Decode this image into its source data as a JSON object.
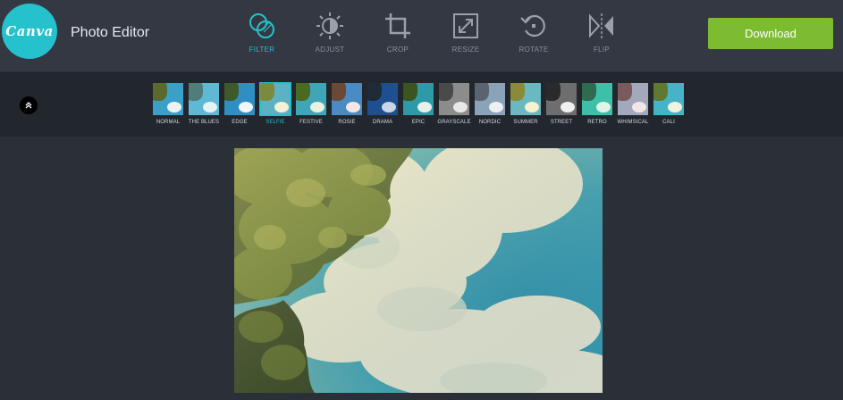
{
  "app": {
    "logo_text": "Canva",
    "title": "Photo Editor"
  },
  "toolbar": {
    "tools": [
      {
        "label": "FILTER",
        "icon": "filter-icon",
        "active": true
      },
      {
        "label": "ADJUST",
        "icon": "adjust-icon",
        "active": false
      },
      {
        "label": "CROP",
        "icon": "crop-icon",
        "active": false
      },
      {
        "label": "RESIZE",
        "icon": "resize-icon",
        "active": false
      },
      {
        "label": "ROTATE",
        "icon": "rotate-icon",
        "active": false
      },
      {
        "label": "FLIP",
        "icon": "flip-icon",
        "active": false
      }
    ],
    "download_label": "Download"
  },
  "filters": {
    "collapse_icon": "chevron-up-icon",
    "selected": "SELFIE",
    "items": [
      {
        "label": "NORMAL",
        "tree": "#5b6a2c",
        "sky": "#3aa0c8",
        "cloud": "#eef3f2"
      },
      {
        "label": "THE BLUES",
        "tree": "#4f7d7a",
        "sky": "#5fb8d4",
        "cloud": "#e6f2f4"
      },
      {
        "label": "EDGE",
        "tree": "#3e5a2a",
        "sky": "#2f8fc4",
        "cloud": "#f2f6f7"
      },
      {
        "label": "SELFIE",
        "tree": "#7b8a3c",
        "sky": "#5cb2c2",
        "cloud": "#f4f0d6"
      },
      {
        "label": "FESTIVE",
        "tree": "#4a6a22",
        "sky": "#3fa6b8",
        "cloud": "#eaf1e0"
      },
      {
        "label": "ROSIE",
        "tree": "#6a4a36",
        "sky": "#4a8bc4",
        "cloud": "#f6e7e4"
      },
      {
        "label": "DRAMA",
        "tree": "#1f2c38",
        "sky": "#1e4f8e",
        "cloud": "#c9d6e6"
      },
      {
        "label": "EPIC",
        "tree": "#3b5420",
        "sky": "#2e9aa8",
        "cloud": "#e9f0ea"
      },
      {
        "label": "GRAYSCALE",
        "tree": "#4a4a4a",
        "sky": "#8c8c8c",
        "cloud": "#e8e8e8"
      },
      {
        "label": "NORDIC",
        "tree": "#5a6470",
        "sky": "#8aa3b8",
        "cloud": "#eef1f4"
      },
      {
        "label": "SUMMER",
        "tree": "#8a8a38",
        "sky": "#6ab8c0",
        "cloud": "#f6f1cf"
      },
      {
        "label": "STREET",
        "tree": "#2a2a2a",
        "sky": "#6e6e6e",
        "cloud": "#f0f0f0"
      },
      {
        "label": "RETRO",
        "tree": "#2f6b50",
        "sky": "#3dbfa8",
        "cloud": "#e2f4ea"
      },
      {
        "label": "WHIMSICAL",
        "tree": "#7a5a5a",
        "sky": "#a3a8bc",
        "cloud": "#f4e6e6"
      },
      {
        "label": "CALI",
        "tree": "#5f7a30",
        "sky": "#46b4c8",
        "cloud": "#f1f3dd"
      }
    ]
  },
  "colors": {
    "accent": "#25c1cc",
    "download": "#7dbb31",
    "topbar": "#333843",
    "filterbar": "#22262d",
    "background": "#2b2f38"
  }
}
